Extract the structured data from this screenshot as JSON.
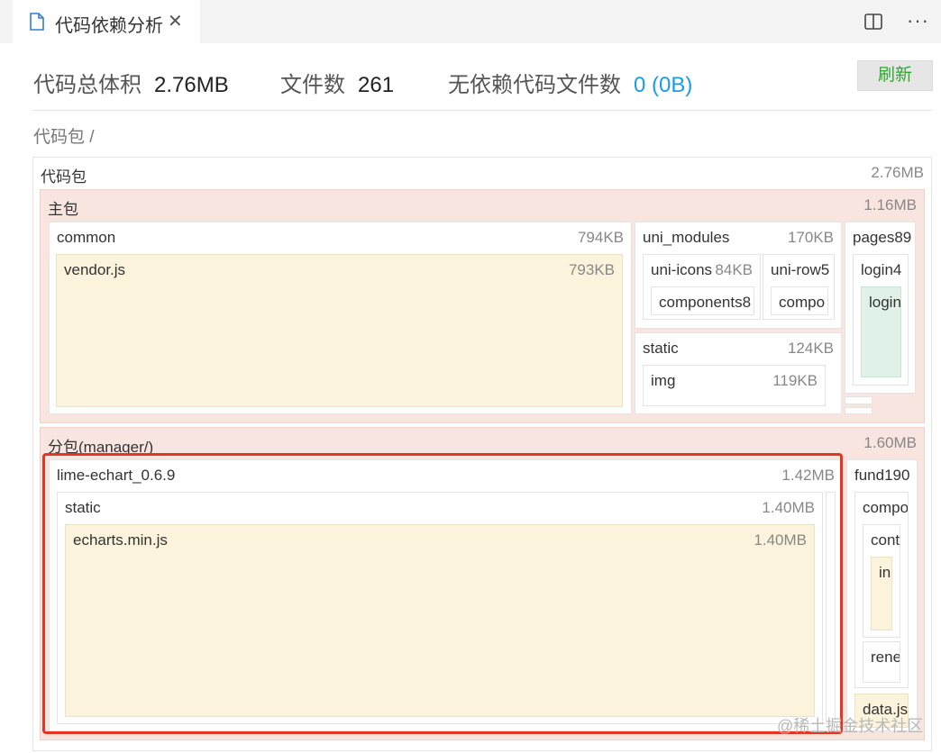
{
  "tab": {
    "title": "代码依赖分析",
    "file_icon": "file-icon",
    "close_label": "✕"
  },
  "toolbar": {
    "split_icon": "split-editor-icon",
    "more_label": "···"
  },
  "stats": {
    "total_label": "代码总体积",
    "total_value": "2.76MB",
    "files_label": "文件数",
    "files_value": "261",
    "nodep_label": "无依赖代码文件数",
    "nodep_value": "0 (0B)"
  },
  "refresh_label": "刷新",
  "breadcrumb": "代码包 /",
  "treemap": {
    "root": {
      "name": "代码包",
      "size": "2.76MB"
    },
    "main": {
      "name": "主包",
      "size": "1.16MB"
    },
    "common": {
      "name": "common",
      "size": "794KB"
    },
    "vendor": {
      "name": "vendor.js",
      "size": "793KB"
    },
    "uni_modules": {
      "name": "uni_modules",
      "size": "170KB"
    },
    "uni_icons": {
      "name": "uni-icons",
      "size": "84KB"
    },
    "uni_icons_components": {
      "name": "components8"
    },
    "uni_row": {
      "name": "uni-row5"
    },
    "uni_row_components": {
      "name": "compo"
    },
    "static": {
      "name": "static",
      "size": "124KB"
    },
    "img": {
      "name": "img",
      "size": "119KB"
    },
    "pages": {
      "name": "pages89"
    },
    "login_dir": {
      "name": "login4"
    },
    "login_file": {
      "name": "login"
    },
    "sub": {
      "name": "分包(manager/)",
      "size": "1.60MB"
    },
    "lime": {
      "name": "lime-echart_0.6.9",
      "size": "1.42MB"
    },
    "lime_static": {
      "name": "static",
      "size": "1.40MB"
    },
    "echarts": {
      "name": "echarts.min.js",
      "size": "1.40MB"
    },
    "fund": {
      "name": "fund190"
    },
    "fund_compo": {
      "name": "compo"
    },
    "fund_cont": {
      "name": "cont"
    },
    "fund_in": {
      "name": "in"
    },
    "fund_rene": {
      "name": "rene"
    },
    "fund_data": {
      "name": "data.js"
    }
  },
  "watermark": "@稀土掘金技术社区",
  "colors": {
    "highlight": "#e53525",
    "link_blue": "#1a9ce6",
    "refresh_green": "#2eaa2e"
  }
}
